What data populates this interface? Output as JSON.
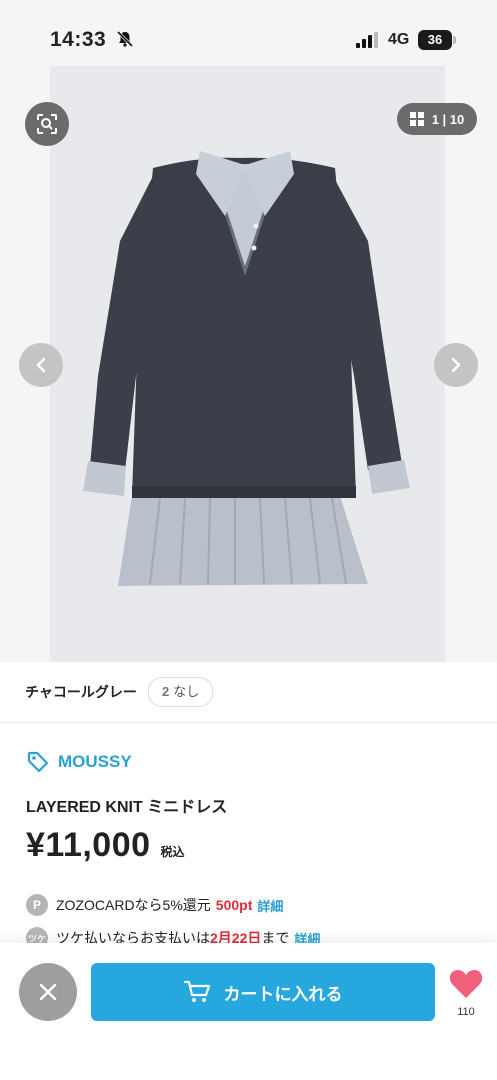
{
  "status_bar": {
    "time": "14:33",
    "network": "4G",
    "battery": "36"
  },
  "gallery": {
    "counter": "1 | 10"
  },
  "variant": {
    "color_name": "チャコールグレー",
    "size_label": "2",
    "stock_text": "なし"
  },
  "product": {
    "brand": "MOUSSY",
    "name": "LAYERED KNIT ミニドレス",
    "price": "¥11,000",
    "tax_label": "税込"
  },
  "promos": [
    {
      "icon": "P",
      "text": "ZOZOCARDなら5%還元",
      "highlight": "500pt",
      "link": "詳細"
    },
    {
      "icon": "ツケ",
      "text_before": "ツケ払いならお支払いは",
      "highlight": "2月22日",
      "text_after": "まで",
      "link": "詳細"
    }
  ],
  "actions": {
    "add_to_cart": "カートに入れる",
    "favorite_count": "110"
  },
  "colors": {
    "accent": "#26a7de",
    "brand": "#2aa1d6",
    "sale_red": "#e02c3a",
    "favorite": "#f0607a"
  }
}
